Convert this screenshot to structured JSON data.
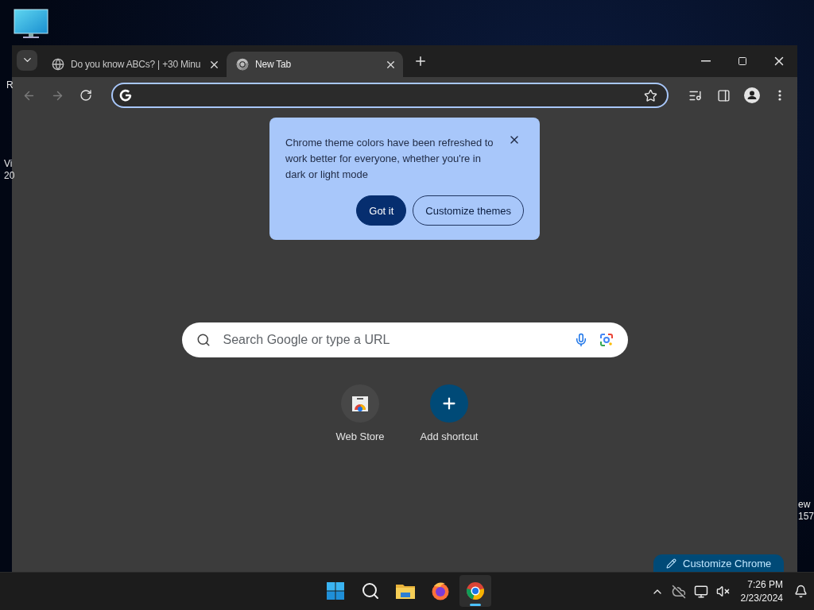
{
  "desktop": {
    "left_fragments": [
      "R",
      "Vi",
      "20"
    ],
    "right_fragments": [
      "ew",
      "157"
    ]
  },
  "browser": {
    "tabs": [
      {
        "title": "Do you know ABCs? | +30 Minu",
        "kind": "web",
        "selected": false
      },
      {
        "title": "New Tab",
        "kind": "chrome",
        "selected": true
      }
    ],
    "nav": [
      {
        "kind": "back",
        "disabled": true
      },
      {
        "kind": "forward",
        "disabled": true
      },
      {
        "kind": "reload",
        "disabled": false
      }
    ],
    "bubble": {
      "message": "Chrome theme colors have been refreshed to work better for everyone, whether you're in dark or light mode",
      "buttons": [
        {
          "label": "Got it",
          "kind": "primary"
        },
        {
          "label": "Customize themes",
          "kind": "outline"
        }
      ]
    },
    "search": {
      "placeholder": "Search Google or type a URL"
    },
    "shortcuts": [
      {
        "label": "Web Store",
        "kind": "store"
      },
      {
        "label": "Add shortcut",
        "kind": "add"
      }
    ],
    "customize_button": {
      "label": "Customize Chrome"
    }
  },
  "taskbar": {
    "apps": [
      {
        "kind": "start",
        "selected": false
      },
      {
        "kind": "search",
        "selected": false
      },
      {
        "kind": "explorer",
        "selected": false
      },
      {
        "kind": "firefox",
        "selected": false
      },
      {
        "kind": "chrome",
        "selected": true
      }
    ],
    "clock": {
      "time": "7:26 PM",
      "date": "2/23/2024"
    }
  }
}
